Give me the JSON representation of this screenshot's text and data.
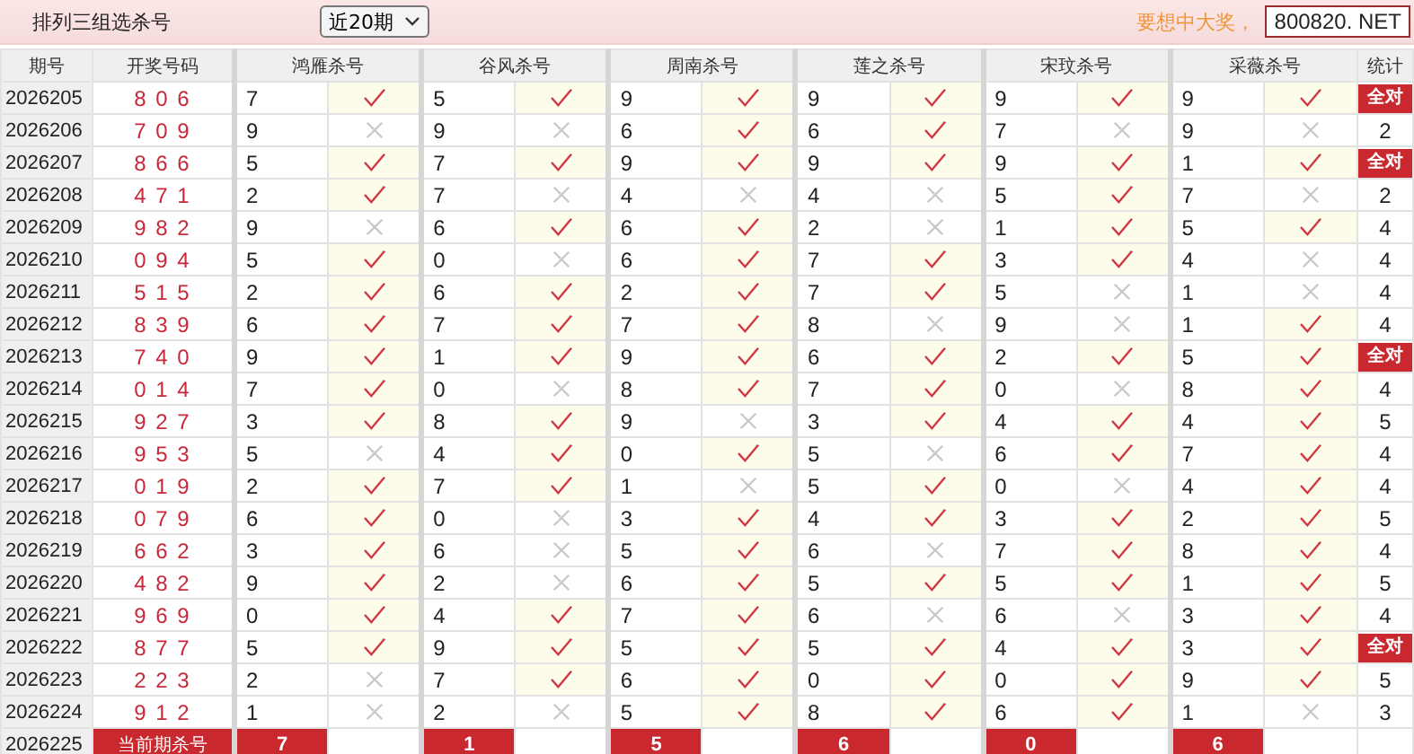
{
  "header": {
    "title": "排列三组选杀号",
    "range": "近20期",
    "slogan": "要想中大奖，",
    "site": "800820. NET"
  },
  "columns": {
    "period": "期号",
    "draw": "开奖号码",
    "groups": [
      "鸿雁杀号",
      "谷风杀号",
      "周南杀号",
      "莲之杀号",
      "宋玟杀号",
      "采薇杀号"
    ],
    "stat": "统计"
  },
  "rows": [
    {
      "period": "2026205",
      "draw": "8 0 6",
      "kills": [
        {
          "num": "7",
          "hit": true
        },
        {
          "num": "5",
          "hit": true
        },
        {
          "num": "9",
          "hit": true
        },
        {
          "num": "9",
          "hit": true
        },
        {
          "num": "9",
          "hit": true
        },
        {
          "num": "9",
          "hit": true
        }
      ],
      "stat": "全对",
      "badge": true
    },
    {
      "period": "2026206",
      "draw": "7 0 9",
      "kills": [
        {
          "num": "9",
          "hit": false
        },
        {
          "num": "9",
          "hit": false
        },
        {
          "num": "6",
          "hit": true
        },
        {
          "num": "6",
          "hit": true
        },
        {
          "num": "7",
          "hit": false
        },
        {
          "num": "9",
          "hit": false
        }
      ],
      "stat": "2",
      "badge": false
    },
    {
      "period": "2026207",
      "draw": "8 6 6",
      "kills": [
        {
          "num": "5",
          "hit": true
        },
        {
          "num": "7",
          "hit": true
        },
        {
          "num": "9",
          "hit": true
        },
        {
          "num": "9",
          "hit": true
        },
        {
          "num": "9",
          "hit": true
        },
        {
          "num": "1",
          "hit": true
        }
      ],
      "stat": "全对",
      "badge": true
    },
    {
      "period": "2026208",
      "draw": "4 7 1",
      "kills": [
        {
          "num": "2",
          "hit": true
        },
        {
          "num": "7",
          "hit": false
        },
        {
          "num": "4",
          "hit": false
        },
        {
          "num": "4",
          "hit": false
        },
        {
          "num": "5",
          "hit": true
        },
        {
          "num": "7",
          "hit": false
        }
      ],
      "stat": "2",
      "badge": false
    },
    {
      "period": "2026209",
      "draw": "9 8 2",
      "kills": [
        {
          "num": "9",
          "hit": false
        },
        {
          "num": "6",
          "hit": true
        },
        {
          "num": "6",
          "hit": true
        },
        {
          "num": "2",
          "hit": false
        },
        {
          "num": "1",
          "hit": true
        },
        {
          "num": "5",
          "hit": true
        }
      ],
      "stat": "4",
      "badge": false
    },
    {
      "period": "2026210",
      "draw": "0 9 4",
      "kills": [
        {
          "num": "5",
          "hit": true
        },
        {
          "num": "0",
          "hit": false
        },
        {
          "num": "6",
          "hit": true
        },
        {
          "num": "7",
          "hit": true
        },
        {
          "num": "3",
          "hit": true
        },
        {
          "num": "4",
          "hit": false
        }
      ],
      "stat": "4",
      "badge": false
    },
    {
      "period": "2026211",
      "draw": "5 1 5",
      "kills": [
        {
          "num": "2",
          "hit": true
        },
        {
          "num": "6",
          "hit": true
        },
        {
          "num": "2",
          "hit": true
        },
        {
          "num": "7",
          "hit": true
        },
        {
          "num": "5",
          "hit": false
        },
        {
          "num": "1",
          "hit": false
        }
      ],
      "stat": "4",
      "badge": false
    },
    {
      "period": "2026212",
      "draw": "8 3 9",
      "kills": [
        {
          "num": "6",
          "hit": true
        },
        {
          "num": "7",
          "hit": true
        },
        {
          "num": "7",
          "hit": true
        },
        {
          "num": "8",
          "hit": false
        },
        {
          "num": "9",
          "hit": false
        },
        {
          "num": "1",
          "hit": true
        }
      ],
      "stat": "4",
      "badge": false
    },
    {
      "period": "2026213",
      "draw": "7 4 0",
      "kills": [
        {
          "num": "9",
          "hit": true
        },
        {
          "num": "1",
          "hit": true
        },
        {
          "num": "9",
          "hit": true
        },
        {
          "num": "6",
          "hit": true
        },
        {
          "num": "2",
          "hit": true
        },
        {
          "num": "5",
          "hit": true
        }
      ],
      "stat": "全对",
      "badge": true
    },
    {
      "period": "2026214",
      "draw": "0 1 4",
      "kills": [
        {
          "num": "7",
          "hit": true
        },
        {
          "num": "0",
          "hit": false
        },
        {
          "num": "8",
          "hit": true
        },
        {
          "num": "7",
          "hit": true
        },
        {
          "num": "0",
          "hit": false
        },
        {
          "num": "8",
          "hit": true
        }
      ],
      "stat": "4",
      "badge": false
    },
    {
      "period": "2026215",
      "draw": "9 2 7",
      "kills": [
        {
          "num": "3",
          "hit": true
        },
        {
          "num": "8",
          "hit": true
        },
        {
          "num": "9",
          "hit": false
        },
        {
          "num": "3",
          "hit": true
        },
        {
          "num": "4",
          "hit": true
        },
        {
          "num": "4",
          "hit": true
        }
      ],
      "stat": "5",
      "badge": false
    },
    {
      "period": "2026216",
      "draw": "9 5 3",
      "kills": [
        {
          "num": "5",
          "hit": false
        },
        {
          "num": "4",
          "hit": true
        },
        {
          "num": "0",
          "hit": true
        },
        {
          "num": "5",
          "hit": false
        },
        {
          "num": "6",
          "hit": true
        },
        {
          "num": "7",
          "hit": true
        }
      ],
      "stat": "4",
      "badge": false
    },
    {
      "period": "2026217",
      "draw": "0 1 9",
      "kills": [
        {
          "num": "2",
          "hit": true
        },
        {
          "num": "7",
          "hit": true
        },
        {
          "num": "1",
          "hit": false
        },
        {
          "num": "5",
          "hit": true
        },
        {
          "num": "0",
          "hit": false
        },
        {
          "num": "4",
          "hit": true
        }
      ],
      "stat": "4",
      "badge": false
    },
    {
      "period": "2026218",
      "draw": "0 7 9",
      "kills": [
        {
          "num": "6",
          "hit": true
        },
        {
          "num": "0",
          "hit": false
        },
        {
          "num": "3",
          "hit": true
        },
        {
          "num": "4",
          "hit": true
        },
        {
          "num": "3",
          "hit": true
        },
        {
          "num": "2",
          "hit": true
        }
      ],
      "stat": "5",
      "badge": false
    },
    {
      "period": "2026219",
      "draw": "6 6 2",
      "kills": [
        {
          "num": "3",
          "hit": true
        },
        {
          "num": "6",
          "hit": false
        },
        {
          "num": "5",
          "hit": true
        },
        {
          "num": "6",
          "hit": false
        },
        {
          "num": "7",
          "hit": true
        },
        {
          "num": "8",
          "hit": true
        }
      ],
      "stat": "4",
      "badge": false
    },
    {
      "period": "2026220",
      "draw": "4 8 2",
      "kills": [
        {
          "num": "9",
          "hit": true
        },
        {
          "num": "2",
          "hit": false
        },
        {
          "num": "6",
          "hit": true
        },
        {
          "num": "5",
          "hit": true
        },
        {
          "num": "5",
          "hit": true
        },
        {
          "num": "1",
          "hit": true
        }
      ],
      "stat": "5",
      "badge": false
    },
    {
      "period": "2026221",
      "draw": "9 6 9",
      "kills": [
        {
          "num": "0",
          "hit": true
        },
        {
          "num": "4",
          "hit": true
        },
        {
          "num": "7",
          "hit": true
        },
        {
          "num": "6",
          "hit": false
        },
        {
          "num": "6",
          "hit": false
        },
        {
          "num": "3",
          "hit": true
        }
      ],
      "stat": "4",
      "badge": false
    },
    {
      "period": "2026222",
      "draw": "8 7 7",
      "kills": [
        {
          "num": "5",
          "hit": true
        },
        {
          "num": "9",
          "hit": true
        },
        {
          "num": "5",
          "hit": true
        },
        {
          "num": "5",
          "hit": true
        },
        {
          "num": "4",
          "hit": true
        },
        {
          "num": "3",
          "hit": true
        }
      ],
      "stat": "全对",
      "badge": true
    },
    {
      "period": "2026223",
      "draw": "2 2 3",
      "kills": [
        {
          "num": "2",
          "hit": false
        },
        {
          "num": "7",
          "hit": true
        },
        {
          "num": "6",
          "hit": true
        },
        {
          "num": "0",
          "hit": true
        },
        {
          "num": "0",
          "hit": true
        },
        {
          "num": "9",
          "hit": true
        }
      ],
      "stat": "5",
      "badge": false
    },
    {
      "period": "2026224",
      "draw": "9 1 2",
      "kills": [
        {
          "num": "1",
          "hit": false
        },
        {
          "num": "2",
          "hit": false
        },
        {
          "num": "5",
          "hit": true
        },
        {
          "num": "8",
          "hit": true
        },
        {
          "num": "6",
          "hit": true
        },
        {
          "num": "1",
          "hit": false
        }
      ],
      "stat": "3",
      "badge": false
    }
  ],
  "current": {
    "period": "2026225",
    "label": "当前期杀号",
    "kills": [
      "7",
      "1",
      "5",
      "6",
      "0",
      "6"
    ]
  }
}
